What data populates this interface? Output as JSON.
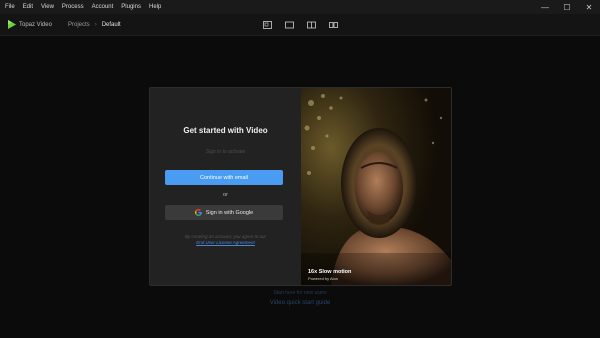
{
  "menu": [
    "File",
    "Edit",
    "View",
    "Process",
    "Account",
    "Plugins",
    "Help"
  ],
  "window_controls": {
    "minimize": "—",
    "maximize": "☐",
    "close": "✕"
  },
  "app": {
    "name": "Topaz Video",
    "accent": "#6bd43a"
  },
  "breadcrumb": {
    "projects": "Projects",
    "separator": "›",
    "current": "Default"
  },
  "view_buttons": [
    "single-view-icon",
    "crop-view-icon",
    "split-view-icon",
    "side-by-side-view-icon"
  ],
  "dialog": {
    "title": "Get started with Video",
    "signin_hint": "Sign in to activate",
    "email_button": "Continue with email",
    "or": "or",
    "google_button": "Sign in with Google",
    "legal_text": "By creating an account, you agree to our",
    "legal_link": "End User License Agreement",
    "caption_title": "16x Slow motion",
    "caption_sub": "Powered by Aion",
    "primary_color": "#4a9cf2"
  },
  "footer": {
    "start_here": "Start here for new users",
    "quick_guide": "Video quick start guide"
  }
}
